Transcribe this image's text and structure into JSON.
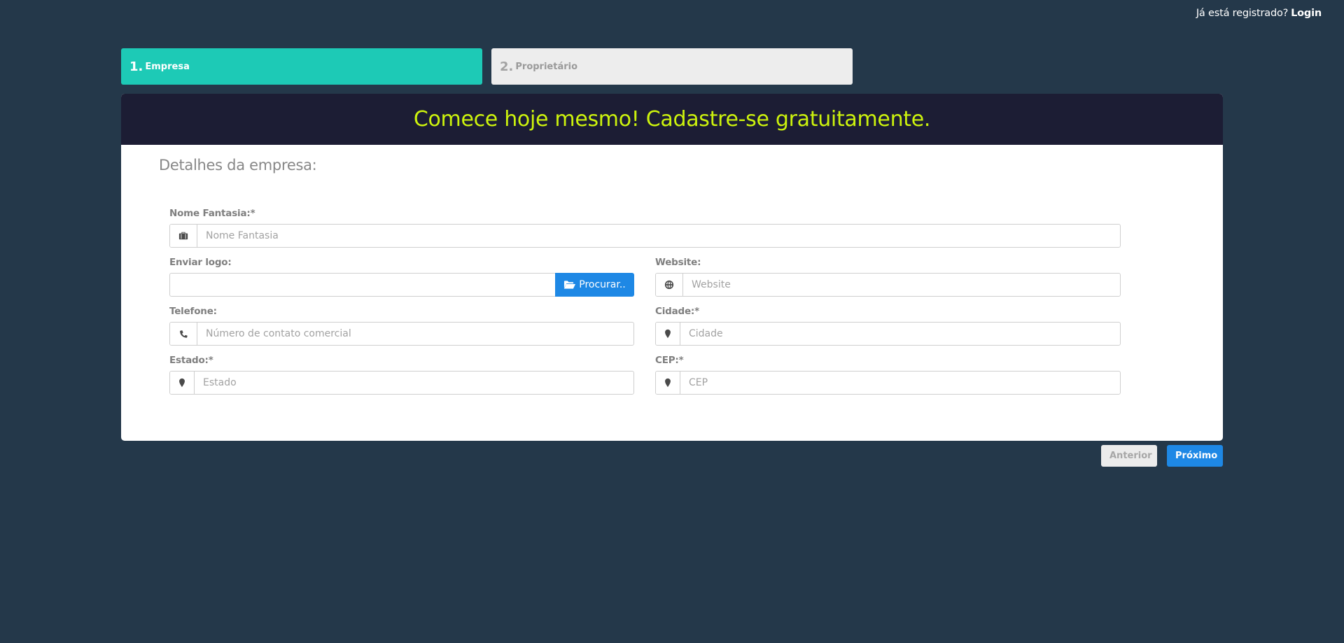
{
  "header": {
    "already_registered": "Já está registrado?",
    "login_label": "Login"
  },
  "steps": [
    {
      "number": "1.",
      "label": "Empresa",
      "active": true
    },
    {
      "number": "2.",
      "label": "Proprietário",
      "active": false
    }
  ],
  "card": {
    "title": "Comece hoje mesmo! Cadastre-se gratuitamente.",
    "section_title": "Detalhes da empresa:"
  },
  "form": {
    "nome_fantasia": {
      "label": "Nome Fantasia:*",
      "placeholder": "Nome Fantasia",
      "value": "",
      "icon": "briefcase-icon"
    },
    "logo": {
      "label": "Enviar logo:",
      "button_label": "Procurar..",
      "icon": "folder-open-icon"
    },
    "website": {
      "label": "Website:",
      "placeholder": "Website",
      "value": "",
      "icon": "globe-icon"
    },
    "telefone": {
      "label": "Telefone:",
      "placeholder": "Número de contato comercial",
      "value": "",
      "icon": "phone-icon"
    },
    "cidade": {
      "label": "Cidade:*",
      "placeholder": "Cidade",
      "value": "",
      "icon": "map-marker-icon"
    },
    "estado": {
      "label": "Estado:*",
      "placeholder": "Estado",
      "value": "",
      "icon": "map-marker-icon"
    },
    "cep": {
      "label": "CEP:*",
      "placeholder": "CEP",
      "value": "",
      "icon": "map-marker-icon"
    }
  },
  "nav": {
    "prev_label": "Anterior",
    "next_label": "Próximo"
  },
  "colors": {
    "background": "#24384a",
    "step_active": "#1dcab6",
    "step_inactive": "#ededed",
    "card_header": "#1c1d34",
    "title_text": "#ccf20d",
    "primary": "#1e88e5"
  }
}
